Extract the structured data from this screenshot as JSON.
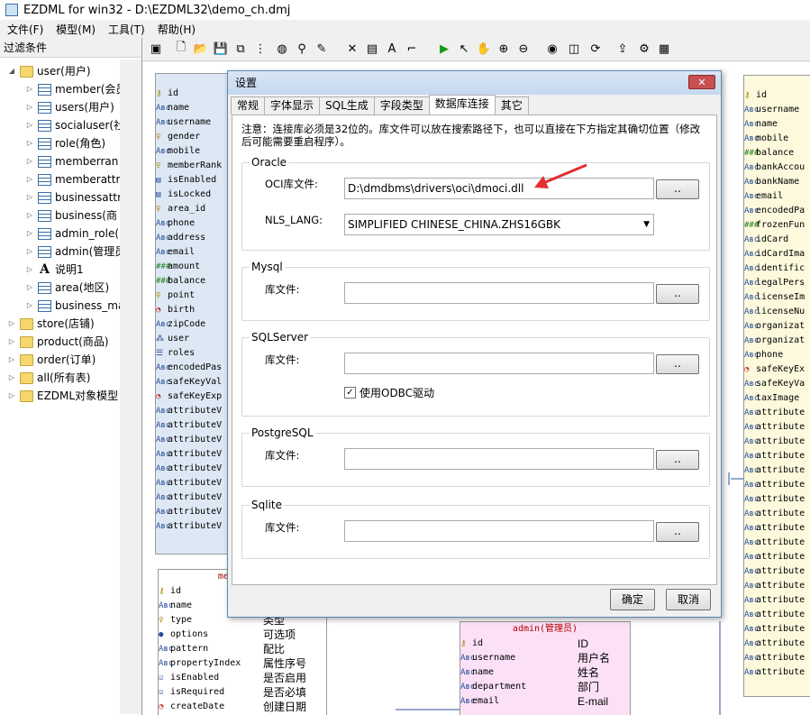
{
  "window": {
    "title": "EZDML for win32 - D:\\EZDML32\\demo_ch.dmj"
  },
  "menu": [
    "文件(F)",
    "模型(M)",
    "工具(T)",
    "帮助(H)"
  ],
  "left_panel": {
    "caption": "过滤条件",
    "tree": [
      {
        "label": "user(用户)",
        "icon": "folder-icon",
        "level": 1,
        "expanded": true
      },
      {
        "label": "member(会员",
        "icon": "table-icon",
        "level": 2
      },
      {
        "label": "users(用户)",
        "icon": "table-icon",
        "level": 2
      },
      {
        "label": "socialuser(社",
        "icon": "table-icon",
        "level": 2
      },
      {
        "label": "role(角色)",
        "icon": "table-icon",
        "level": 2
      },
      {
        "label": "memberran",
        "icon": "table-icon",
        "level": 2
      },
      {
        "label": "memberattr",
        "icon": "table-icon",
        "level": 2
      },
      {
        "label": "businessattr",
        "icon": "table-icon",
        "level": 2
      },
      {
        "label": "business(商",
        "icon": "table-icon",
        "level": 2
      },
      {
        "label": "admin_role(",
        "icon": "table-icon",
        "level": 2
      },
      {
        "label": "admin(管理员",
        "icon": "table-icon",
        "level": 2
      },
      {
        "label": "说明1",
        "icon": "text-icon",
        "level": 2
      },
      {
        "label": "area(地区)",
        "icon": "table-icon",
        "level": 2
      },
      {
        "label": "business_ma",
        "icon": "table-icon",
        "level": 2
      },
      {
        "label": "store(店铺)",
        "icon": "folder-icon",
        "level": 1
      },
      {
        "label": "product(商品)",
        "icon": "folder-icon",
        "level": 1
      },
      {
        "label": "order(订单)",
        "icon": "folder-icon",
        "level": 1
      },
      {
        "label": "all(所有表)",
        "icon": "folder-icon",
        "level": 1
      },
      {
        "label": "EZDML对象模型",
        "icon": "folder-icon",
        "level": 1
      }
    ]
  },
  "toolbar_icons": [
    "model-icon",
    "new-icon",
    "open-icon",
    "save-icon",
    "copy-icon",
    "tree-icon",
    "globe-icon",
    "find-icon",
    "pen-icon",
    "delete-icon",
    "table-add-icon",
    "text-add-icon",
    "link-icon",
    "run-icon",
    "pointer-icon",
    "hand-icon",
    "zoom-in-icon",
    "zoom-out-icon",
    "eye-icon",
    "db-icon",
    "refresh-icon",
    "export-icon",
    "settings-icon",
    "image-icon"
  ],
  "entity_user": {
    "fields": [
      {
        "icon": "key",
        "name": "id"
      },
      {
        "icon": "Abc",
        "name": "name"
      },
      {
        "icon": "Abc",
        "name": "username"
      },
      {
        "icon": "bulb",
        "name": "gender"
      },
      {
        "icon": "Abc",
        "name": "mobile"
      },
      {
        "icon": "bulb",
        "name": "memberRank"
      },
      {
        "icon": "bool",
        "name": "isEnabled"
      },
      {
        "icon": "bool",
        "name": "isLocked"
      },
      {
        "icon": "bulb",
        "name": "area_id"
      },
      {
        "icon": "Abc",
        "name": "phone"
      },
      {
        "icon": "Abc",
        "name": "address"
      },
      {
        "icon": "Abc",
        "name": "email"
      },
      {
        "icon": "num",
        "name": "amount"
      },
      {
        "icon": "num",
        "name": "balance"
      },
      {
        "icon": "bulb",
        "name": "point"
      },
      {
        "icon": "clock",
        "name": "birth"
      },
      {
        "icon": "Abc",
        "name": "zipCode"
      },
      {
        "icon": "obj",
        "name": "user"
      },
      {
        "icon": "list",
        "name": "roles"
      },
      {
        "icon": "Abc",
        "name": "encodedPas"
      },
      {
        "icon": "Abc",
        "name": "safeKeyVal"
      },
      {
        "icon": "clock",
        "name": "safeKeyExp"
      },
      {
        "icon": "Abc",
        "name": "attributeV"
      },
      {
        "icon": "Abc",
        "name": "attributeV"
      },
      {
        "icon": "Abc",
        "name": "attributeV"
      },
      {
        "icon": "Abc",
        "name": "attributeV"
      },
      {
        "icon": "Abc",
        "name": "attributeV"
      },
      {
        "icon": "Abc",
        "name": "attributeV"
      },
      {
        "icon": "Abc",
        "name": "attributeV"
      },
      {
        "icon": "Abc",
        "name": "attributeV"
      },
      {
        "icon": "Abc",
        "name": "attributeV"
      }
    ]
  },
  "entity_memberattr": {
    "title": "memberatt",
    "fields": [
      {
        "icon": "key",
        "name": "id",
        "cn": ""
      },
      {
        "icon": "Abc",
        "name": "name",
        "cn": ""
      },
      {
        "icon": "bulb",
        "name": "type",
        "cn": "类型"
      },
      {
        "icon": "dot",
        "name": "options",
        "cn": "可选项"
      },
      {
        "icon": "Abc",
        "name": "pattern",
        "cn": "配比"
      },
      {
        "icon": "Abc",
        "name": "propertyIndex",
        "cn": "属性序号"
      },
      {
        "icon": "check",
        "name": "isEnabled",
        "cn": "是否启用"
      },
      {
        "icon": "check",
        "name": "isRequired",
        "cn": "是否必填"
      },
      {
        "icon": "clock",
        "name": "createDate",
        "cn": "创建日期"
      }
    ]
  },
  "entity_admin": {
    "title": "admin(管理员)",
    "fields": [
      {
        "icon": "key",
        "name": "id",
        "cn": "ID"
      },
      {
        "icon": "Abc",
        "name": "username",
        "cn": "用户名"
      },
      {
        "icon": "Abc",
        "name": "name",
        "cn": "姓名"
      },
      {
        "icon": "Abc",
        "name": "department",
        "cn": "部门"
      },
      {
        "icon": "Abc",
        "name": "email",
        "cn": "E-mail"
      }
    ]
  },
  "entity_right": {
    "fields": [
      {
        "icon": "key",
        "name": "id"
      },
      {
        "icon": "Abc",
        "name": "username"
      },
      {
        "icon": "Abc",
        "name": "name"
      },
      {
        "icon": "Abc",
        "name": "mobile"
      },
      {
        "icon": "num",
        "name": "balance"
      },
      {
        "icon": "Abc",
        "name": "bankAccou"
      },
      {
        "icon": "Abc",
        "name": "bankName"
      },
      {
        "icon": "Abc",
        "name": "email"
      },
      {
        "icon": "Abc",
        "name": "encodedPa"
      },
      {
        "icon": "num",
        "name": "frozenFun"
      },
      {
        "icon": "Abc",
        "name": "idCard"
      },
      {
        "icon": "Abc",
        "name": "idCardIma"
      },
      {
        "icon": "Abc",
        "name": "identific"
      },
      {
        "icon": "Abc",
        "name": "legalPers"
      },
      {
        "icon": "Abc",
        "name": "licenseIm"
      },
      {
        "icon": "Abc",
        "name": "licenseNu"
      },
      {
        "icon": "Abc",
        "name": "organizat"
      },
      {
        "icon": "Abc",
        "name": "organizat"
      },
      {
        "icon": "Abc",
        "name": "phone"
      },
      {
        "icon": "clock",
        "name": "safeKeyEx"
      },
      {
        "icon": "Abc",
        "name": "safeKeyVa"
      },
      {
        "icon": "Abc",
        "name": "taxImage"
      },
      {
        "icon": "Abc",
        "name": "attribute"
      },
      {
        "icon": "Abc",
        "name": "attribute"
      },
      {
        "icon": "Abc",
        "name": "attribute"
      },
      {
        "icon": "Abc",
        "name": "attribute"
      },
      {
        "icon": "Abc",
        "name": "attribute"
      },
      {
        "icon": "Abc",
        "name": "attribute"
      },
      {
        "icon": "Abc",
        "name": "attribute"
      },
      {
        "icon": "Abc",
        "name": "attribute"
      },
      {
        "icon": "Abc",
        "name": "attribute"
      },
      {
        "icon": "Abc",
        "name": "attribute"
      },
      {
        "icon": "Abc",
        "name": "attribute"
      },
      {
        "icon": "Abc",
        "name": "attribute"
      },
      {
        "icon": "Abc",
        "name": "attribute"
      },
      {
        "icon": "Abc",
        "name": "attribute"
      },
      {
        "icon": "Abc",
        "name": "attribute"
      },
      {
        "icon": "Abc",
        "name": "attribute"
      },
      {
        "icon": "Abc",
        "name": "attribute"
      },
      {
        "icon": "Abc",
        "name": "attribute"
      },
      {
        "icon": "Abc",
        "name": "attribute"
      }
    ]
  },
  "dialog": {
    "title": "设置",
    "close_label": "✕",
    "tabs": [
      "常规",
      "字体显示",
      "SQL生成",
      "字段类型",
      "数据库连接",
      "其它"
    ],
    "active_tab": 4,
    "note": "注意：连接库必须是32位的。库文件可以放在搜索路径下，也可以直接在下方指定其确切位置（修改后可能需要重启程序）。",
    "oracle": {
      "title": "Oracle",
      "oci_label": "OCI库文件:",
      "oci_value": "D:\\dmdbms\\drivers\\oci\\dmoci.dll",
      "nls_label": "NLS_LANG:",
      "nls_value": "SIMPLIFIED CHINESE_CHINA.ZHS16GBK"
    },
    "mysql": {
      "title": "Mysql",
      "lib_label": "库文件:",
      "lib_value": ""
    },
    "sqlserver": {
      "title": "SQLServer",
      "lib_label": "库文件:",
      "lib_value": "",
      "odbc_label": "使用ODBC驱动",
      "odbc_checked": true
    },
    "postgresql": {
      "title": "PostgreSQL",
      "lib_label": "库文件:",
      "lib_value": ""
    },
    "sqlite": {
      "title": "Sqlite",
      "lib_label": "库文件:",
      "lib_value": ""
    },
    "browse_label": "..",
    "ok_label": "确定",
    "cancel_label": "取消"
  },
  "colors": {
    "accent": "#3a6ea5",
    "entity_user_bg": "#dde8f4",
    "entity_right_bg": "#fdf9dd",
    "entity_admin_bg": "#fbe0f7",
    "annotation_arrow": "#e03030"
  }
}
